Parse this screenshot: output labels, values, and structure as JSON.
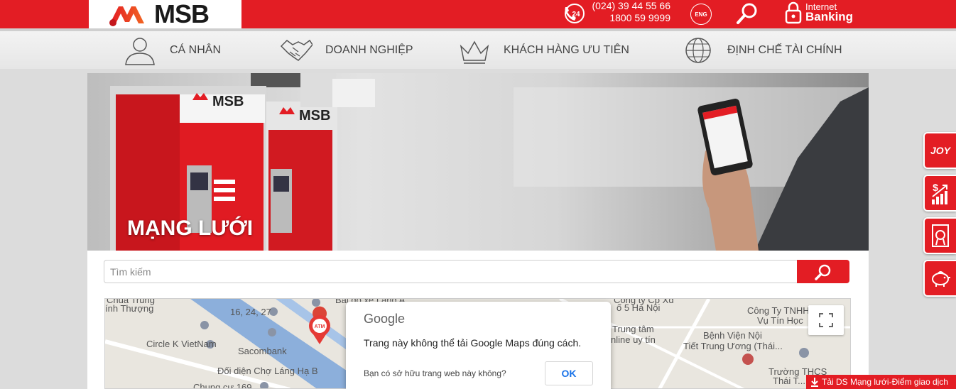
{
  "header": {
    "logo_text": "MSB",
    "hotline_line1": "(024) 39 44 55 66",
    "hotline_line2": "1800 59 9999",
    "hotline_icon_label": "24",
    "lang_label": "ENG",
    "internet_banking_line1": "Internet",
    "internet_banking_line2": "Banking"
  },
  "nav": {
    "items": [
      {
        "label": "CÁ NHÂN",
        "icon": "person-icon"
      },
      {
        "label": "DOANH NGHIỆP",
        "icon": "handshake-icon"
      },
      {
        "label": "KHÁCH HÀNG ƯU TIÊN",
        "icon": "crown-icon"
      },
      {
        "label": "ĐỊNH CHẾ TÀI CHÍNH",
        "icon": "globe-icon"
      }
    ]
  },
  "banner": {
    "title": "MẠNG LƯỚI",
    "booth_logo": "MSB"
  },
  "search": {
    "placeholder": "Tìm kiếm"
  },
  "map": {
    "labels": [
      "Chùa Trung",
      "ính Thượng",
      "16, 24, 27",
      "Circle K VietNam",
      "Sacombank",
      "Đối diện Chợ Láng Hạ B",
      "Chung cư 169",
      "Bãi đỗ xe Láng A",
      "Công ty Cp Xd",
      "ố 5 Hà Nội",
      "Trung tâm",
      "nline uy tín",
      "Công Ty TNHH",
      "Vụ Tín Học",
      "Bệnh Viện Nội",
      "Tiết Trung Ương (Thái...",
      "Trường THCS",
      "Thái T..."
    ],
    "atm_label": "ATM"
  },
  "google_dialog": {
    "brand": "Google",
    "message": "Trang này không thể tải Google Maps đúng cách.",
    "question": "Bạn có sở hữu trang web này không?",
    "ok_label": "OK"
  },
  "side": {
    "joy_label": "JOY"
  },
  "download": {
    "label": "Tải DS Mạng lưới-Điểm giao dịch"
  },
  "colors": {
    "brand_red": "#e31d24",
    "nav_bg": "#ececec",
    "google_blue": "#1a73e8"
  }
}
